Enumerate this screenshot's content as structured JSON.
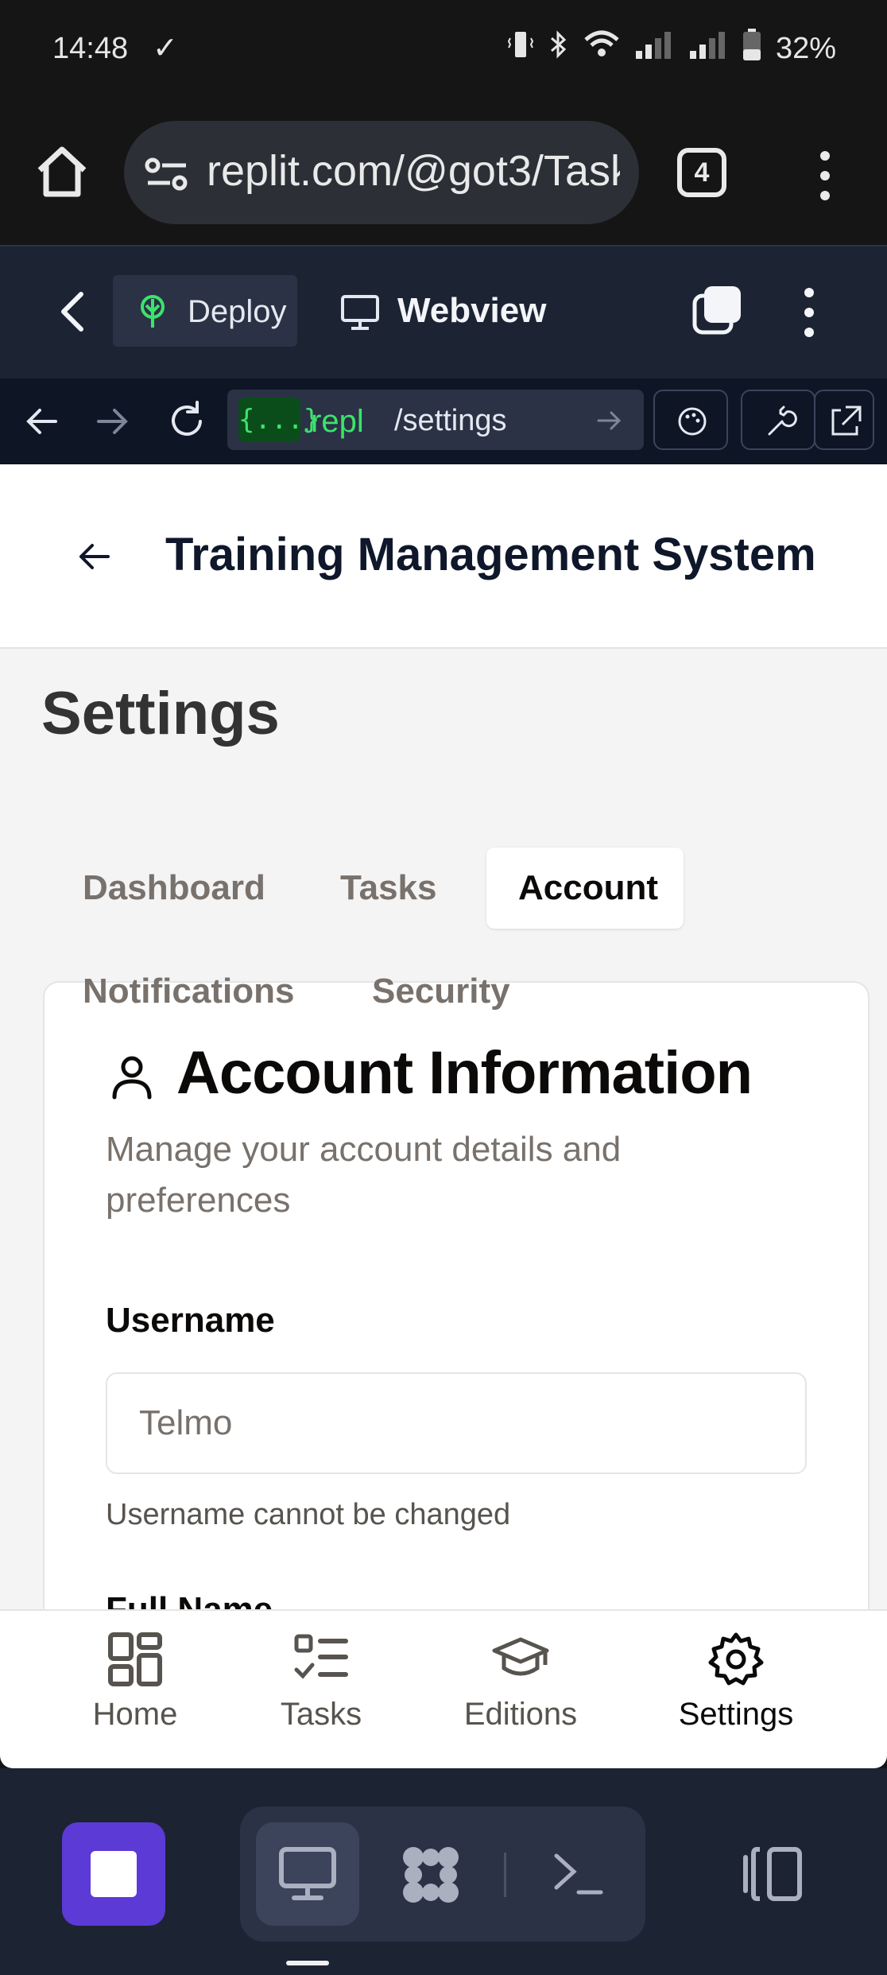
{
  "status_bar": {
    "time": "14:48",
    "battery": "32%"
  },
  "browser": {
    "url": "replit.com/@got3/Task",
    "tab_count": "4"
  },
  "replit_header": {
    "deploy_label": "Deploy",
    "webview_label": "Webview"
  },
  "webview_toolbar": {
    "badge": "{...}",
    "domain": ".repl",
    "path": "/settings"
  },
  "app": {
    "title": "Training Management System"
  },
  "page": {
    "title": "Settings",
    "tabs": [
      {
        "label": "Dashboard",
        "active": false
      },
      {
        "label": "Tasks",
        "active": false
      },
      {
        "label": "Account",
        "active": true
      },
      {
        "label": "Notifications",
        "active": false
      },
      {
        "label": "Security",
        "active": false
      }
    ]
  },
  "account_card": {
    "title": "Account Information",
    "description": "Manage your account details and preferences",
    "username_label": "Username",
    "username_value": "Telmo",
    "username_hint": "Username cannot be changed",
    "fullname_label": "Full Name"
  },
  "bottom_nav": [
    {
      "label": "Home",
      "icon": "grid-icon",
      "active": false
    },
    {
      "label": "Tasks",
      "icon": "list-check-icon",
      "active": false
    },
    {
      "label": "Editions",
      "icon": "graduation-cap-icon",
      "active": false
    },
    {
      "label": "Settings",
      "icon": "gear-icon",
      "active": true
    }
  ],
  "colors": {
    "accent_purple": "#5b3ad6",
    "repl_green": "#3ce36b",
    "replit_header_bg": "#1c2333"
  }
}
